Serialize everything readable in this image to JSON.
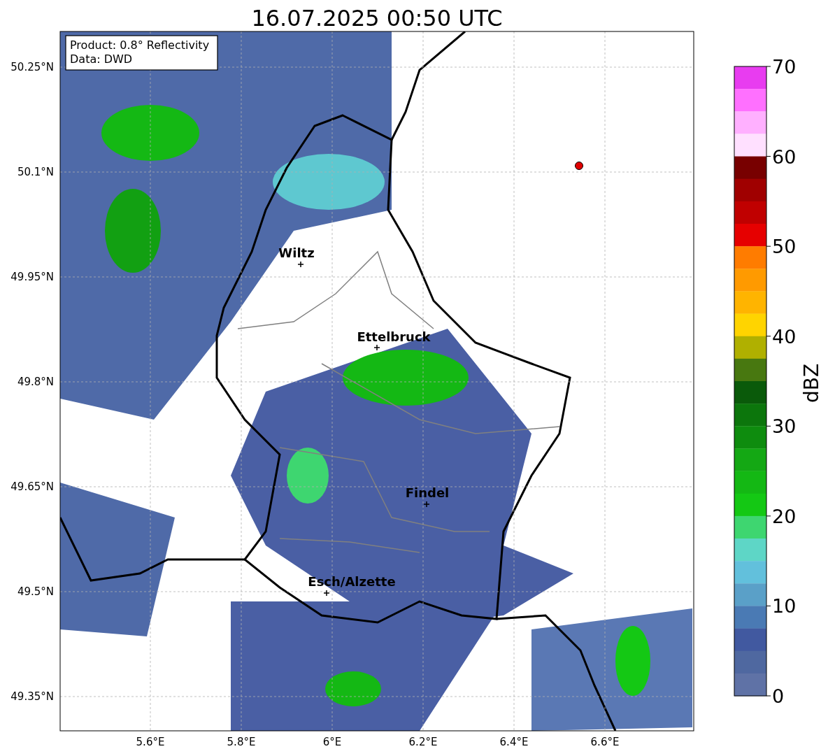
{
  "title": "16.07.2025 00:50 UTC",
  "info_box": [
    "Product: 0.8° Reflectivity",
    "Data: DWD"
  ],
  "yticks": [
    "50.25°N",
    "50.1°N",
    "49.95°N",
    "49.8°N",
    "49.65°N",
    "49.5°N",
    "49.35°N"
  ],
  "xticks": [
    "5.6°E",
    "5.8°E",
    "6°E",
    "6.2°E",
    "6.4°E",
    "6.6°E"
  ],
  "places": [
    {
      "name": "Wiltz"
    },
    {
      "name": "Ettelbruck"
    },
    {
      "name": "Findel"
    },
    {
      "name": "Esch/Alzette"
    }
  ],
  "colorbar": {
    "label": "dBZ",
    "ticks": [
      "70",
      "60",
      "50",
      "40",
      "30",
      "20",
      "10",
      "0"
    ],
    "segments": [
      {
        "color": "#e83cf0"
      },
      {
        "color": "#ff70ff"
      },
      {
        "color": "#ffb0ff"
      },
      {
        "color": "#ffe0ff"
      },
      {
        "color": "#780000"
      },
      {
        "color": "#a00000"
      },
      {
        "color": "#c00000"
      },
      {
        "color": "#e60000"
      },
      {
        "color": "#ff7c00"
      },
      {
        "color": "#ff9a00"
      },
      {
        "color": "#ffb400"
      },
      {
        "color": "#ffd400"
      },
      {
        "color": "#b0b000"
      },
      {
        "color": "#487810"
      },
      {
        "color": "#0a5a0a"
      },
      {
        "color": "#0c760c"
      },
      {
        "color": "#0e8c0e"
      },
      {
        "color": "#14a814"
      },
      {
        "color": "#14b814"
      },
      {
        "color": "#14c814"
      },
      {
        "color": "#3ed670"
      },
      {
        "color": "#5ed6c6"
      },
      {
        "color": "#62c0dc"
      },
      {
        "color": "#5aa0c8"
      },
      {
        "color": "#4a7ab4"
      },
      {
        "color": "#4159a0"
      },
      {
        "color": "#4f68a0"
      },
      {
        "color": "#5f72a6"
      }
    ]
  }
}
